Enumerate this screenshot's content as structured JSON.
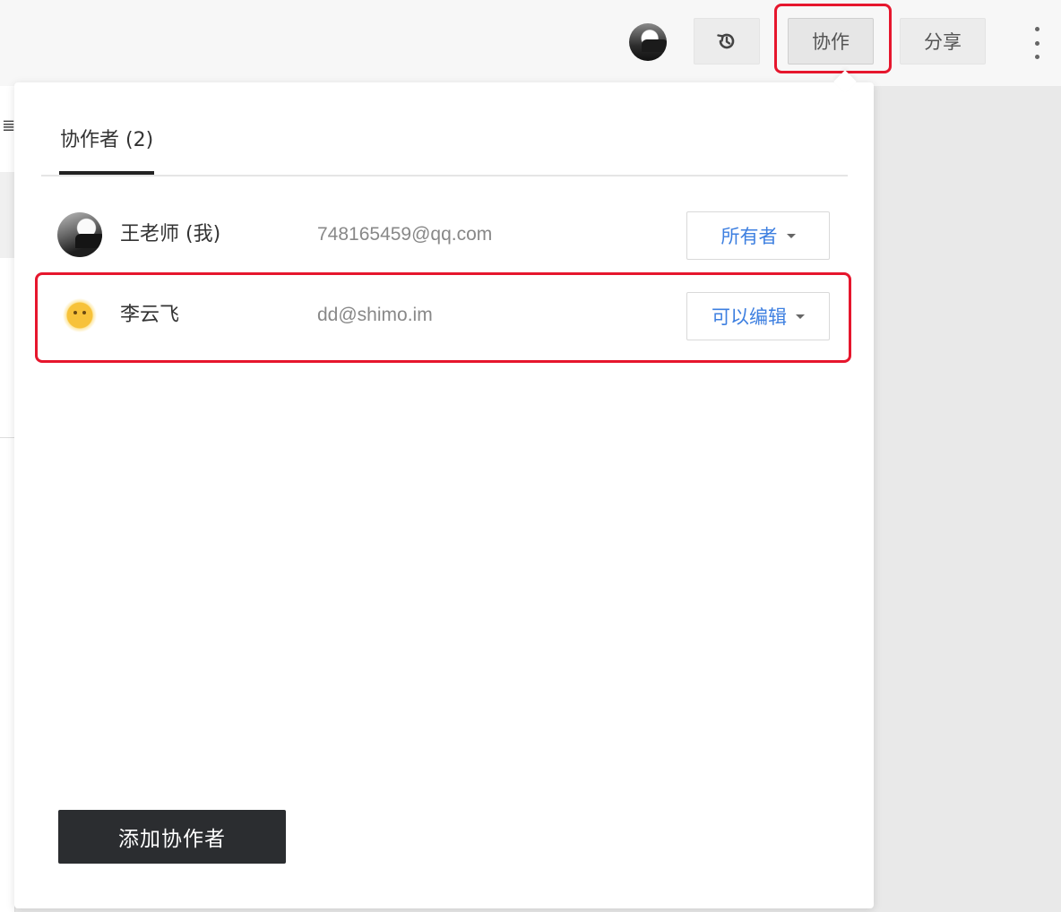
{
  "toolbar": {
    "collaborate_label": "协作",
    "share_label": "分享",
    "icons": [
      "avatar",
      "history-icon",
      "more-vertical-icon"
    ]
  },
  "popover": {
    "tab_label": "协作者 (2)",
    "collaborators": [
      {
        "name": "王老师 (我)",
        "email": "748165459@qq.com",
        "role": "所有者",
        "avatar": "photo"
      },
      {
        "name": "李云飞",
        "email": "dd@shimo.im",
        "role": "可以编辑",
        "avatar": "sun"
      }
    ],
    "add_button_label": "添加协作者"
  },
  "colors": {
    "highlight": "#e6162d",
    "role_link": "#3d7fe0",
    "primary_button": "#2b2d30"
  }
}
